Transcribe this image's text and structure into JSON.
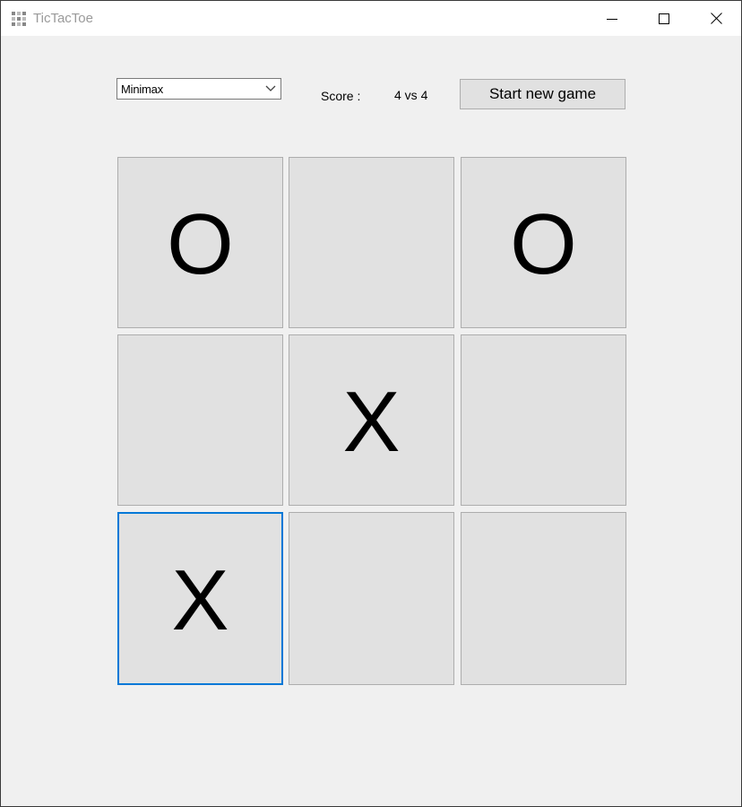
{
  "window": {
    "title": "TicTacToe",
    "icon": "grid-app-icon",
    "controls": [
      "minimize-icon",
      "maximize-icon",
      "close-icon"
    ]
  },
  "toolbar": {
    "algorithm_selected": "Minimax",
    "score_label": "Score :",
    "score_value": "4 vs 4",
    "new_game_label": "Start new game"
  },
  "board": {
    "cells": [
      {
        "mark": "O",
        "focused": false
      },
      {
        "mark": "",
        "focused": false
      },
      {
        "mark": "O",
        "focused": false
      },
      {
        "mark": "",
        "focused": false
      },
      {
        "mark": "X",
        "focused": false
      },
      {
        "mark": "",
        "focused": false
      },
      {
        "mark": "X",
        "focused": true
      },
      {
        "mark": "",
        "focused": false
      },
      {
        "mark": "",
        "focused": false
      }
    ]
  },
  "colors": {
    "focus_border": "#0078d7",
    "cell_background": "#e1e1e1",
    "window_background": "#f0f0f0"
  }
}
